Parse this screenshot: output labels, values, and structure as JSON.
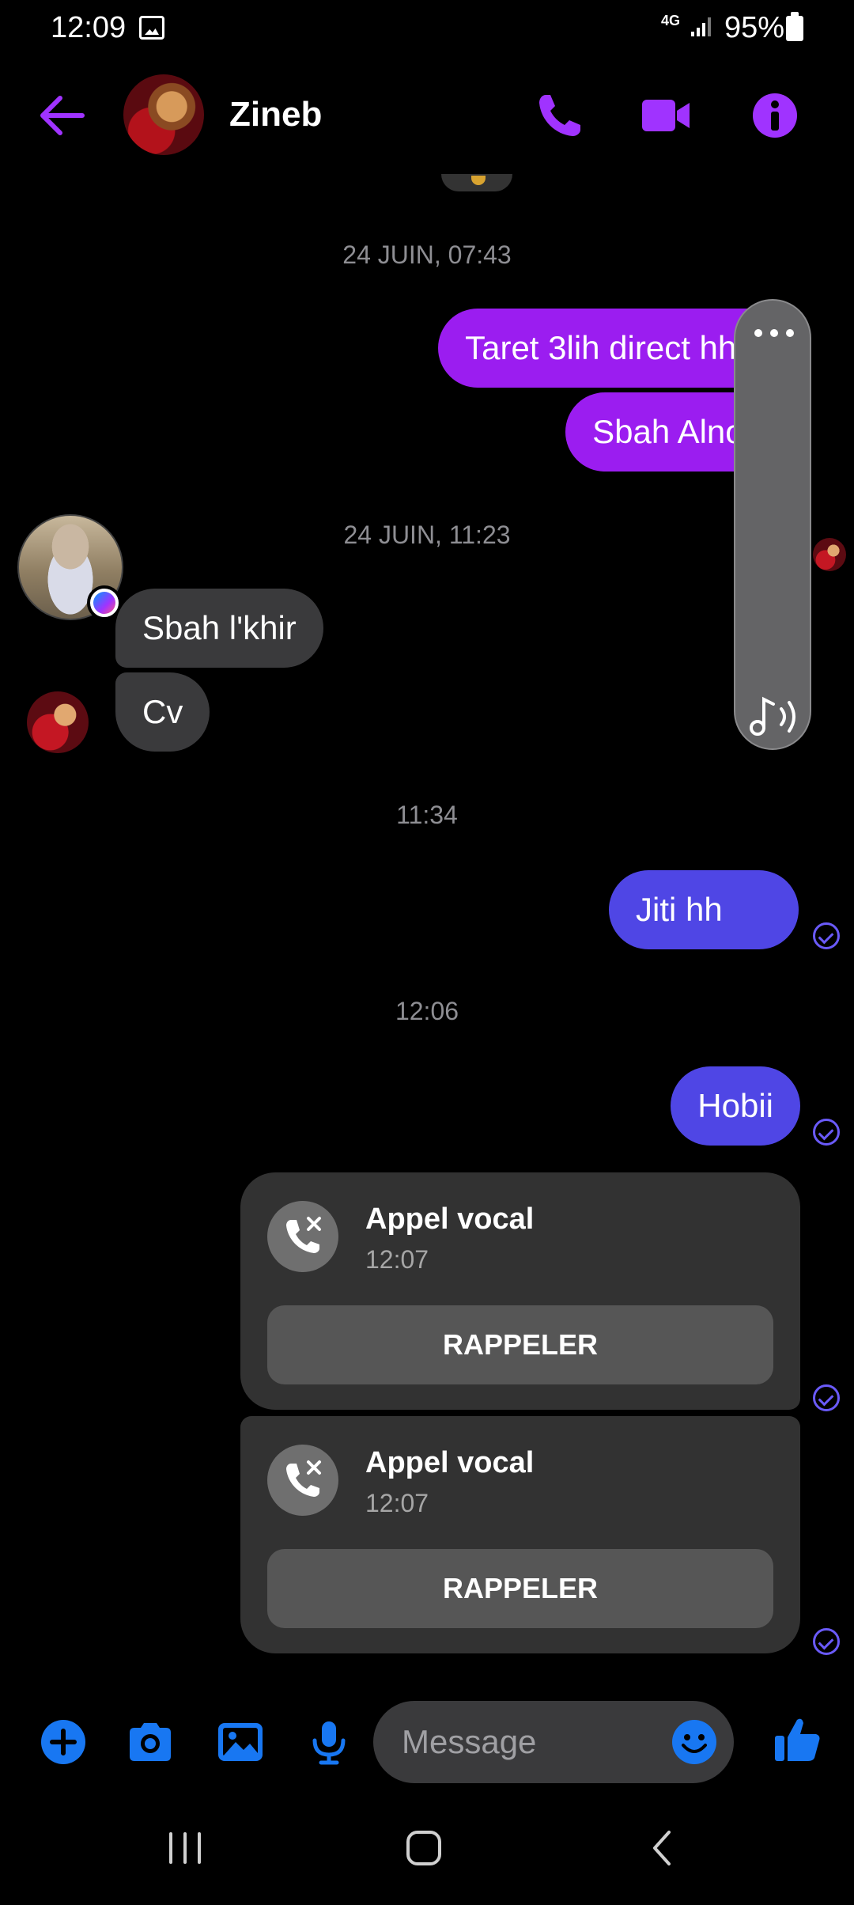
{
  "status_bar": {
    "time": "12:09",
    "network": "4G",
    "battery": "95%"
  },
  "header": {
    "contact_name": "Zineb",
    "accent_color": "#a033ff"
  },
  "messages": {
    "ts1": "24 JUIN, 07:43",
    "m1": "Taret 3lih direct hhhh",
    "m2": "Sbah Alnour",
    "ts2": "24 JUIN, 11:23",
    "m3": "Sbah l'khir",
    "m4": "Cv",
    "ts3": "11:34",
    "m5": "Jiti hh",
    "ts4": "12:06",
    "m6": "Hobii"
  },
  "calls": [
    {
      "title": "Appel vocal",
      "time": "12:07",
      "button": "RAPPELER"
    },
    {
      "title": "Appel vocal",
      "time": "12:07",
      "button": "RAPPELER"
    }
  ],
  "composer": {
    "placeholder": "Message",
    "accent_color": "#1877f2"
  },
  "icons": {
    "back": "back-arrow-icon",
    "call": "phone-icon",
    "video": "video-camera-icon",
    "info": "info-icon",
    "plus": "plus-icon",
    "camera": "camera-icon",
    "gallery": "image-icon",
    "mic": "microphone-icon",
    "emoji": "emoji-icon",
    "like": "thumbs-up-icon"
  }
}
